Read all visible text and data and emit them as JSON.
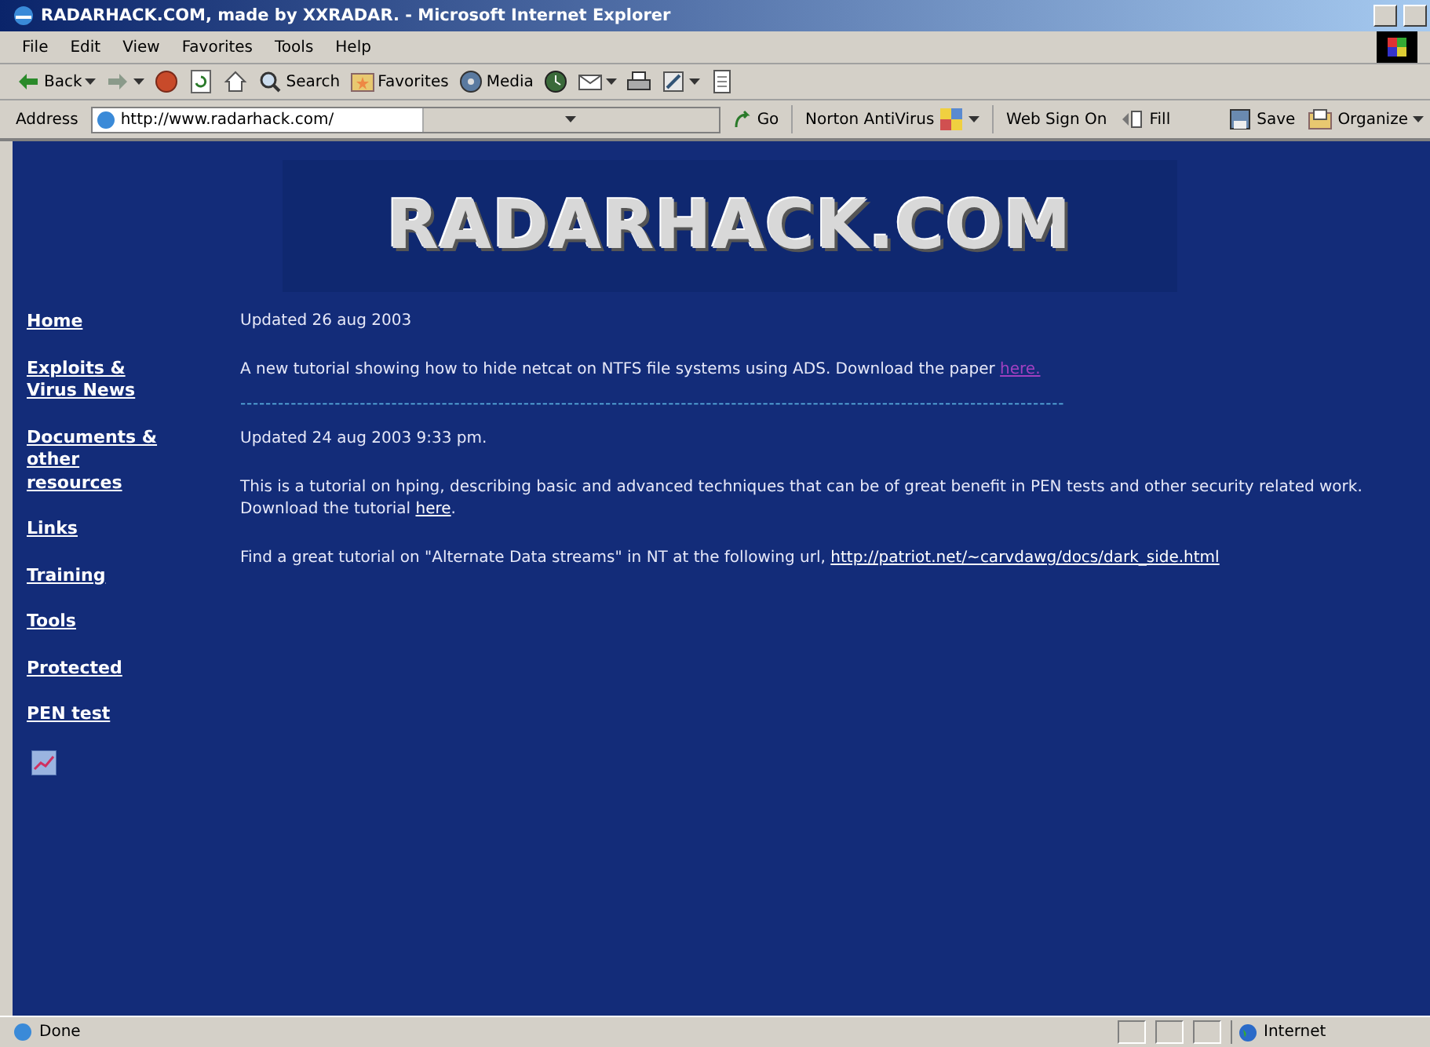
{
  "window": {
    "title": "RADARHACK.COM, made by XXRADAR. - Microsoft Internet Explorer"
  },
  "menu": [
    "File",
    "Edit",
    "View",
    "Favorites",
    "Tools",
    "Help"
  ],
  "toolbar": [
    {
      "kind": "back",
      "label": "Back",
      "dropdown": true
    },
    {
      "kind": "forward",
      "dropdown": true
    },
    {
      "kind": "stop",
      "dropdown": false
    },
    {
      "kind": "refresh",
      "dropdown": false
    },
    {
      "kind": "home",
      "dropdown": false
    },
    {
      "kind": "search",
      "label": "Search",
      "dropdown": false
    },
    {
      "kind": "favorites",
      "label": "Favorites",
      "dropdown": false
    },
    {
      "kind": "media",
      "label": "Media",
      "dropdown": false
    },
    {
      "kind": "history",
      "dropdown": false
    },
    {
      "kind": "mail",
      "dropdown": true
    },
    {
      "kind": "print",
      "dropdown": false
    },
    {
      "kind": "edit",
      "dropdown": true
    },
    {
      "kind": "discuss",
      "dropdown": false
    }
  ],
  "address": {
    "label": "Address",
    "value": "http://www.radarhack.com/",
    "go": "Go"
  },
  "links_bar": [
    {
      "kind": "norton",
      "label": "Norton AntiVirus",
      "dropdown": true
    },
    {
      "kind": "text",
      "label": "Web Sign On",
      "dropdown": false
    },
    {
      "kind": "fill",
      "label": "Fill",
      "dropdown": false
    },
    {
      "kind": "save",
      "label": "Save",
      "dropdown": false
    },
    {
      "kind": "organize",
      "label": "Organize",
      "dropdown": true
    }
  ],
  "page": {
    "banner": "RADARHACK.COM",
    "nav": [
      "Home",
      "Exploits & Virus News",
      "Documents & other resources",
      "Links",
      "Training",
      "Tools",
      "Protected",
      "PEN test"
    ],
    "posts": [
      {
        "kind": "date",
        "text": "Updated 26 aug 2003"
      },
      {
        "kind": "text",
        "text": "A new tutorial showing how to hide netcat on NTFS file systems using ADS. Download the paper ",
        "link": "here.",
        "visited": true
      },
      {
        "kind": "divider",
        "text": "-----------------------------------------------------------------------------------------------------------------------------------"
      },
      {
        "kind": "date",
        "text": "Updated 24 aug 2003 9:33 pm."
      },
      {
        "kind": "text",
        "text": "This is a tutorial on hping, describing basic and advanced techniques that can be of great benefit in PEN tests and other security related work. Download the tutorial ",
        "link": "here",
        "after": ".",
        "visited": false
      },
      {
        "kind": "text",
        "text": "Find a great tutorial on \"Alternate Data streams\" in NT at the following url, ",
        "link": "http://patriot.net/~carvdawg/docs/dark_side.html",
        "visited": false
      }
    ]
  },
  "status": {
    "text": "Done",
    "zone": "Internet"
  }
}
